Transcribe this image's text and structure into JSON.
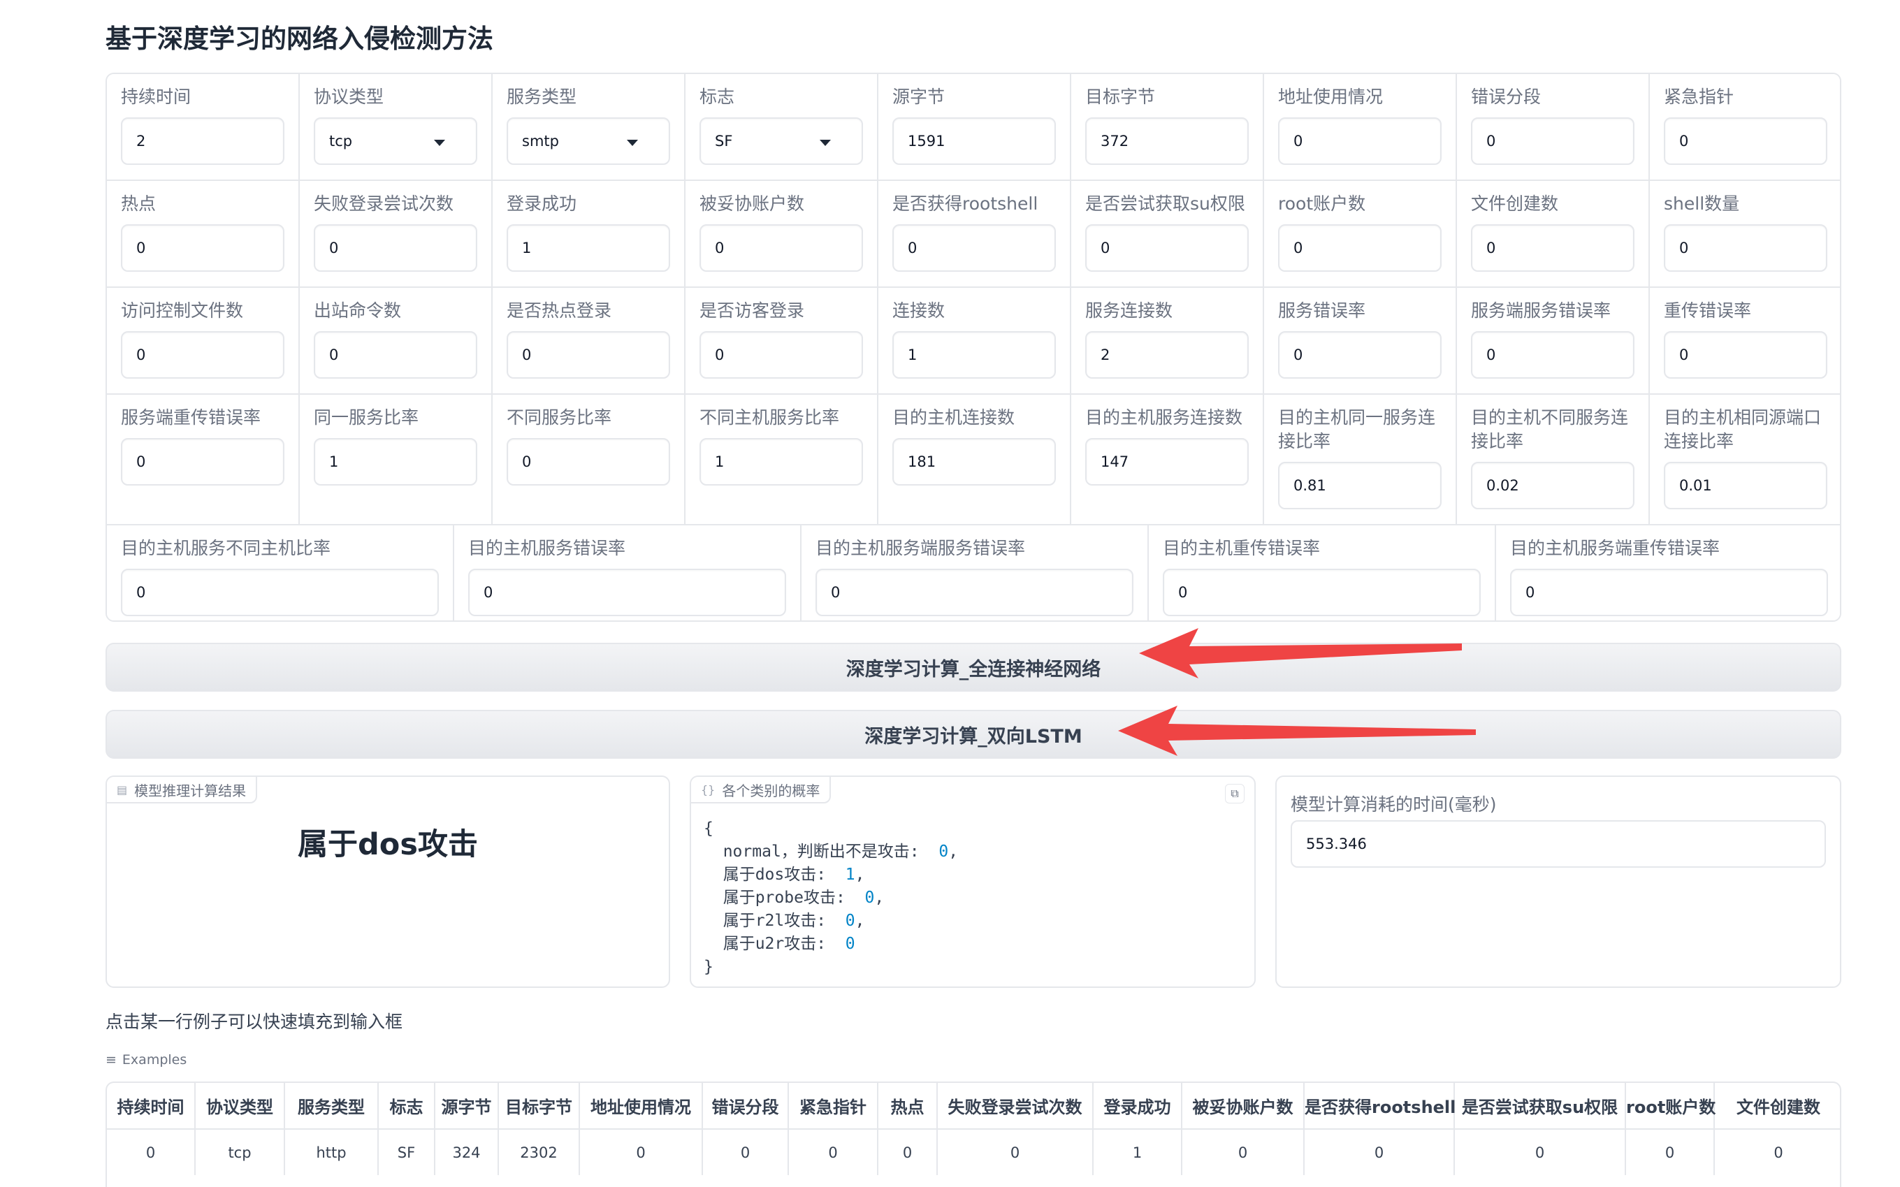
{
  "title": "基于深度学习的网络入侵检测方法",
  "fields": [
    {
      "label": "持续时间",
      "value": "2",
      "type": "input"
    },
    {
      "label": "协议类型",
      "value": "tcp",
      "type": "select"
    },
    {
      "label": "服务类型",
      "value": "smtp",
      "type": "select"
    },
    {
      "label": "标志",
      "value": "SF",
      "type": "select"
    },
    {
      "label": "源字节",
      "value": "1591",
      "type": "input"
    },
    {
      "label": "目标字节",
      "value": "372",
      "type": "input"
    },
    {
      "label": "地址使用情况",
      "value": "0",
      "type": "input"
    },
    {
      "label": "错误分段",
      "value": "0",
      "type": "input"
    },
    {
      "label": "紧急指针",
      "value": "0",
      "type": "input"
    },
    {
      "label": "热点",
      "value": "0",
      "type": "input"
    },
    {
      "label": "失败登录尝试次数",
      "value": "0",
      "type": "input"
    },
    {
      "label": "登录成功",
      "value": "1",
      "type": "input"
    },
    {
      "label": "被妥协账户数",
      "value": "0",
      "type": "input"
    },
    {
      "label": "是否获得rootshell",
      "value": "0",
      "type": "input"
    },
    {
      "label": "是否尝试获取su权限",
      "value": "0",
      "type": "input"
    },
    {
      "label": "root账户数",
      "value": "0",
      "type": "input"
    },
    {
      "label": "文件创建数",
      "value": "0",
      "type": "input"
    },
    {
      "label": "shell数量",
      "value": "0",
      "type": "input"
    },
    {
      "label": "访问控制文件数",
      "value": "0",
      "type": "input"
    },
    {
      "label": "出站命令数",
      "value": "0",
      "type": "input"
    },
    {
      "label": "是否热点登录",
      "value": "0",
      "type": "input"
    },
    {
      "label": "是否访客登录",
      "value": "0",
      "type": "input"
    },
    {
      "label": "连接数",
      "value": "1",
      "type": "input"
    },
    {
      "label": "服务连接数",
      "value": "2",
      "type": "input"
    },
    {
      "label": "服务错误率",
      "value": "0",
      "type": "input"
    },
    {
      "label": "服务端服务错误率",
      "value": "0",
      "type": "input"
    },
    {
      "label": "重传错误率",
      "value": "0",
      "type": "input"
    },
    {
      "label": "服务端重传错误率",
      "value": "0",
      "type": "input"
    },
    {
      "label": "同一服务比率",
      "value": "1",
      "type": "input"
    },
    {
      "label": "不同服务比率",
      "value": "0",
      "type": "input"
    },
    {
      "label": "不同主机服务比率",
      "value": "1",
      "type": "input"
    },
    {
      "label": "目的主机连接数",
      "value": "181",
      "type": "input"
    },
    {
      "label": "目的主机服务连接数",
      "value": "147",
      "type": "input"
    },
    {
      "label": "目的主机同一服务连接比率",
      "value": "0.81",
      "type": "input"
    },
    {
      "label": "目的主机不同服务连接比率",
      "value": "0.02",
      "type": "input"
    },
    {
      "label": "目的主机相同源端口连接比率",
      "value": "0.01",
      "type": "input"
    },
    {
      "label": "目的主机服务不同主机比率",
      "value": "0",
      "type": "input"
    },
    {
      "label": "目的主机服务错误率",
      "value": "0",
      "type": "input"
    },
    {
      "label": "目的主机服务端服务错误率",
      "value": "0",
      "type": "input"
    },
    {
      "label": "目的主机重传错误率",
      "value": "0",
      "type": "input"
    },
    {
      "label": "目的主机服务端重传错误率",
      "value": "0",
      "type": "input"
    }
  ],
  "buttons": {
    "fc": "深度学习计算_全连接神经网络",
    "lstm": "深度学习计算_双向LSTM"
  },
  "result_panel": {
    "label": "模型推理计算结果",
    "text": "属于dos攻击"
  },
  "probs_panel": {
    "label": "各个类别的概率",
    "open": "{",
    "close": "}",
    "items": [
      {
        "key": "normal，判断出不是攻击:",
        "value": "0"
      },
      {
        "key": "属于dos攻击:",
        "value": "1"
      },
      {
        "key": "属于probe攻击:",
        "value": "0"
      },
      {
        "key": "属于r2l攻击:",
        "value": "0"
      },
      {
        "key": "属于u2r攻击:",
        "value": "0"
      }
    ]
  },
  "time_panel": {
    "label": "模型计算消耗的时间(毫秒)",
    "value": "553.346"
  },
  "examples": {
    "hint": "点击某一行例子可以快速填充到输入框",
    "label": "Examples",
    "headers": [
      "持续时间",
      "协议类型",
      "服务类型",
      "标志",
      "源字节",
      "目标字节",
      "地址使用情况",
      "错误分段",
      "紧急指针",
      "热点",
      "失败登录尝试次数",
      "登录成功",
      "被妥协账户数",
      "是否获得rootshell",
      "是否尝试获取su权限",
      "root账户数",
      "文件创建数"
    ],
    "rows": [
      [
        "0",
        "tcp",
        "http",
        "SF",
        "324",
        "2302",
        "0",
        "0",
        "0",
        "0",
        "0",
        "1",
        "0",
        "0",
        "0",
        "0",
        "0"
      ]
    ]
  },
  "colors": {
    "arrow": "#ef4444",
    "border": "#e5e7eb",
    "number": "#0284c7"
  }
}
